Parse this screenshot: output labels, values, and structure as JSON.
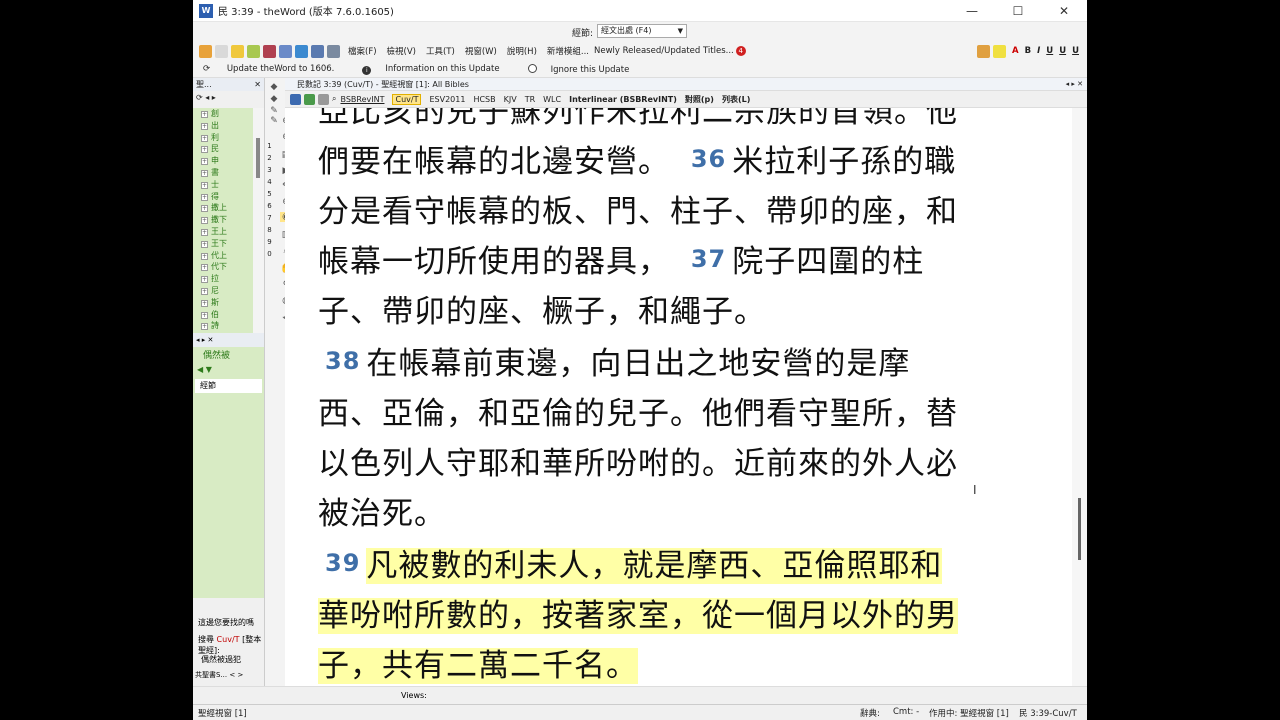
{
  "window": {
    "title": "民 3:39 - theWord (版本 7.6.0.1605)",
    "app_icon_text": "W",
    "minimize": "—",
    "maximize": "☐",
    "close": "✕"
  },
  "toolbar1": {
    "label": "經節:",
    "select_value": "經文出處 (F4)"
  },
  "toolbar2": {
    "menus": [
      "檔案(F)",
      "檢視(V)",
      "工具(T)",
      "視窗(W)",
      "說明(H)"
    ],
    "new_modules": "新增模組...",
    "newly_released": "Newly Released/Updated Titles...",
    "badge": "4",
    "fmt_bold": "B",
    "fmt_italic": "I",
    "fmt_underline": "U"
  },
  "update_bar": {
    "update": "Update theWord to 1606.",
    "info": "Information on this Update",
    "ignore": "Ignore this Update",
    "info_icon": "i"
  },
  "left_panel": {
    "header": "聖...",
    "books": [
      "創",
      "出",
      "利",
      "民",
      "申",
      "書",
      "士",
      "得",
      "撒上",
      "撒下",
      "王上",
      "王下",
      "代上",
      "代下",
      "拉",
      "尼",
      "斯",
      "伯",
      "詩"
    ]
  },
  "search_panel": {
    "input": "偶然被",
    "tab": "經節"
  },
  "left_bottom": {
    "hint": "這邊您要找的嗎",
    "search_label": "搜尋",
    "search_version": "Cuv/T",
    "search_scope": "[整本聖經]:",
    "search_query": "偶然被過犯",
    "tabs": "共聖書S...",
    "prev": "<",
    "next": ">"
  },
  "mid_strip": {
    "numbers": [
      "1",
      "2",
      "3",
      "4",
      "5",
      "6",
      "7",
      "8",
      "9",
      "0"
    ]
  },
  "main_window": {
    "header": "民數記 3:39 (Cuv/T) - 聖經視窗 [1]: All Bibles",
    "controls": "◂ ▸ ✕",
    "versions": [
      "BSBRevINT",
      "Cuv/T",
      "ESV2011",
      "HCSB",
      "KJV",
      "TR",
      "WLC"
    ],
    "interlinear": "Interlinear (BSBRevINT)",
    "parallel": "對照(p)",
    "list": "列表(L)"
  },
  "content": {
    "lines": [
      {
        "v": "",
        "t": "亞比亥的兒子蘇列作米拉利二宗族的首領。他"
      },
      {
        "v": "",
        "t": "們要在帳幕的北邊安營。"
      },
      {
        "v": "",
        "t": "分是看守帳幕的板、門、柱子、帶卯的座，和"
      },
      {
        "v": "",
        "t": "帳幕一切所使用的器具，"
      },
      {
        "v": "",
        "t": "子、帶卯的座、橛子，和繩子。"
      },
      {
        "v": "38",
        "t": "在帳幕前東邊，向日出之地安營的是摩"
      },
      {
        "v": "",
        "t": "西、亞倫，和亞倫的兒子。他們看守聖所，替"
      },
      {
        "v": "",
        "t": "以色列人守耶和華所吩咐的。近前來的外人必"
      },
      {
        "v": "",
        "t": "被治死。"
      },
      {
        "v": "39",
        "t": "凡被數的利未人，就是摩西、亞倫照耶和"
      },
      {
        "v": "",
        "t": "華吩咐所數的，按著家室，從一個月以外的男"
      },
      {
        "v": "",
        "t": "子，共有二萬二千名。"
      }
    ],
    "v36": "36",
    "v36_text": "米拉利子孫的職",
    "v37": "37",
    "v37_text": "院子四圍的柱"
  },
  "views_bar": {
    "label": "Views:"
  },
  "status_bar": {
    "window": "聖經視窗 [1]",
    "dict": "辭典:",
    "cmt": "Cmt: -",
    "active": "作用中: 聖經視窗 [1]",
    "ref": "民 3:39-Cuv/T"
  },
  "colors": {
    "verse_number": "#3f6fa8",
    "highlight": "#ffffa6",
    "panel_green": "#d8ebc4",
    "book_text": "#2d7a1a"
  }
}
